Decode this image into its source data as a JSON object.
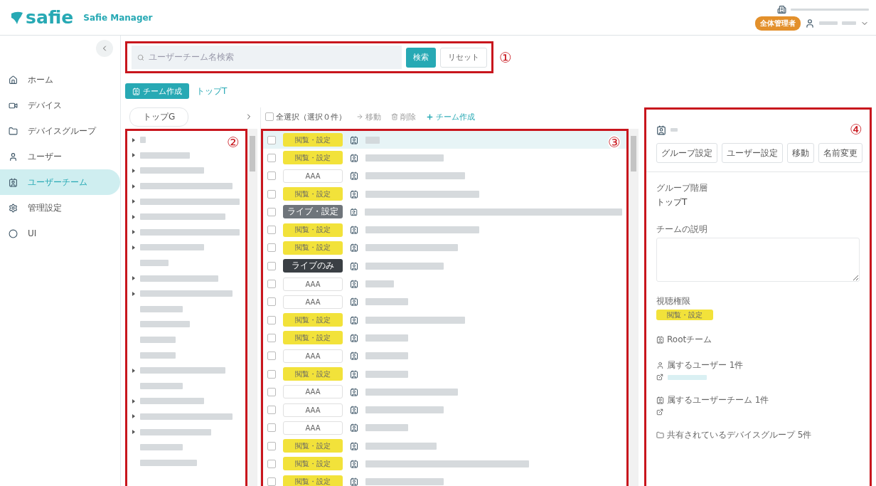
{
  "header": {
    "logo": "safie",
    "app_name": "Safie Manager",
    "role_badge": "全体管理者"
  },
  "sidebar": {
    "items": [
      {
        "label": "ホーム",
        "selected": false
      },
      {
        "label": "デバイス",
        "selected": false
      },
      {
        "label": "デバイスグループ",
        "selected": false
      },
      {
        "label": "ユーザー",
        "selected": false
      },
      {
        "label": "ユーザーチーム",
        "selected": true
      },
      {
        "label": "管理設定",
        "selected": false
      },
      {
        "label": "UI",
        "selected": false
      }
    ]
  },
  "search": {
    "placeholder": "ユーザーチーム名検索",
    "search_button": "検索",
    "reset_button": "リセット",
    "marker": "①"
  },
  "toolbar": {
    "create_button": "チーム作成",
    "breadcrumb": "トップT"
  },
  "tree": {
    "root_button": "トップG",
    "marker": "②",
    "items": [
      {
        "expandable": true
      },
      {
        "expandable": true
      },
      {
        "expandable": true
      },
      {
        "expandable": true
      },
      {
        "expandable": true
      },
      {
        "expandable": true
      },
      {
        "expandable": true
      },
      {
        "expandable": true
      },
      {
        "expandable": false
      },
      {
        "expandable": true
      },
      {
        "expandable": true
      },
      {
        "expandable": false
      },
      {
        "expandable": false
      },
      {
        "expandable": false
      },
      {
        "expandable": false
      },
      {
        "expandable": true
      },
      {
        "expandable": false
      },
      {
        "expandable": true
      },
      {
        "expandable": true
      },
      {
        "expandable": true
      },
      {
        "expandable": false
      },
      {
        "expandable": false
      }
    ]
  },
  "list": {
    "select_all": "全選択（選択０件）",
    "select_all_checked": false,
    "move": "移動",
    "delete": "削除",
    "create": "チーム作成",
    "marker": "③",
    "rows": [
      {
        "badge": "閲覧・設定",
        "kind": "view",
        "selected": true,
        "checked": false
      },
      {
        "badge": "閲覧・設定",
        "kind": "view",
        "selected": false,
        "checked": false
      },
      {
        "badge": "AAA",
        "kind": "custom",
        "selected": false,
        "checked": false
      },
      {
        "badge": "閲覧・設定",
        "kind": "view",
        "selected": false,
        "checked": false
      },
      {
        "badge": "ライブ・設定",
        "kind": "live-setting",
        "selected": false,
        "checked": false
      },
      {
        "badge": "閲覧・設定",
        "kind": "view",
        "selected": false,
        "checked": false
      },
      {
        "badge": "閲覧・設定",
        "kind": "view",
        "selected": false,
        "checked": false
      },
      {
        "badge": "ライブのみ",
        "kind": "live-only",
        "selected": false,
        "checked": false
      },
      {
        "badge": "AAA",
        "kind": "custom",
        "selected": false,
        "checked": false
      },
      {
        "badge": "AAA",
        "kind": "custom",
        "selected": false,
        "checked": false
      },
      {
        "badge": "閲覧・設定",
        "kind": "view",
        "selected": false,
        "checked": false
      },
      {
        "badge": "閲覧・設定",
        "kind": "view",
        "selected": false,
        "checked": false
      },
      {
        "badge": "AAA",
        "kind": "custom",
        "selected": false,
        "checked": false
      },
      {
        "badge": "閲覧・設定",
        "kind": "view",
        "selected": false,
        "checked": false
      },
      {
        "badge": "AAA",
        "kind": "custom",
        "selected": false,
        "checked": false
      },
      {
        "badge": "AAA",
        "kind": "custom",
        "selected": false,
        "checked": false
      },
      {
        "badge": "AAA",
        "kind": "custom",
        "selected": false,
        "checked": false
      },
      {
        "badge": "閲覧・設定",
        "kind": "view",
        "selected": false,
        "checked": false
      },
      {
        "badge": "閲覧・設定",
        "kind": "view",
        "selected": false,
        "checked": false
      },
      {
        "badge": "閲覧・設定",
        "kind": "view",
        "selected": false,
        "checked": false
      }
    ]
  },
  "detail": {
    "marker": "④",
    "buttons": [
      "グループ設定",
      "ユーザー設定",
      "移動",
      "名前変更"
    ],
    "hierarchy_label": "グループ階層",
    "hierarchy_value": "トップT",
    "description_label": "チームの説明",
    "permission_label": "視聴権限",
    "permission_badge": "閲覧・設定",
    "root_team": "Rootチーム",
    "users": "属するユーザー 1件",
    "user_teams": "属するユーザーチーム 1件",
    "device_groups": "共有されているデバイスグループ 5件"
  }
}
